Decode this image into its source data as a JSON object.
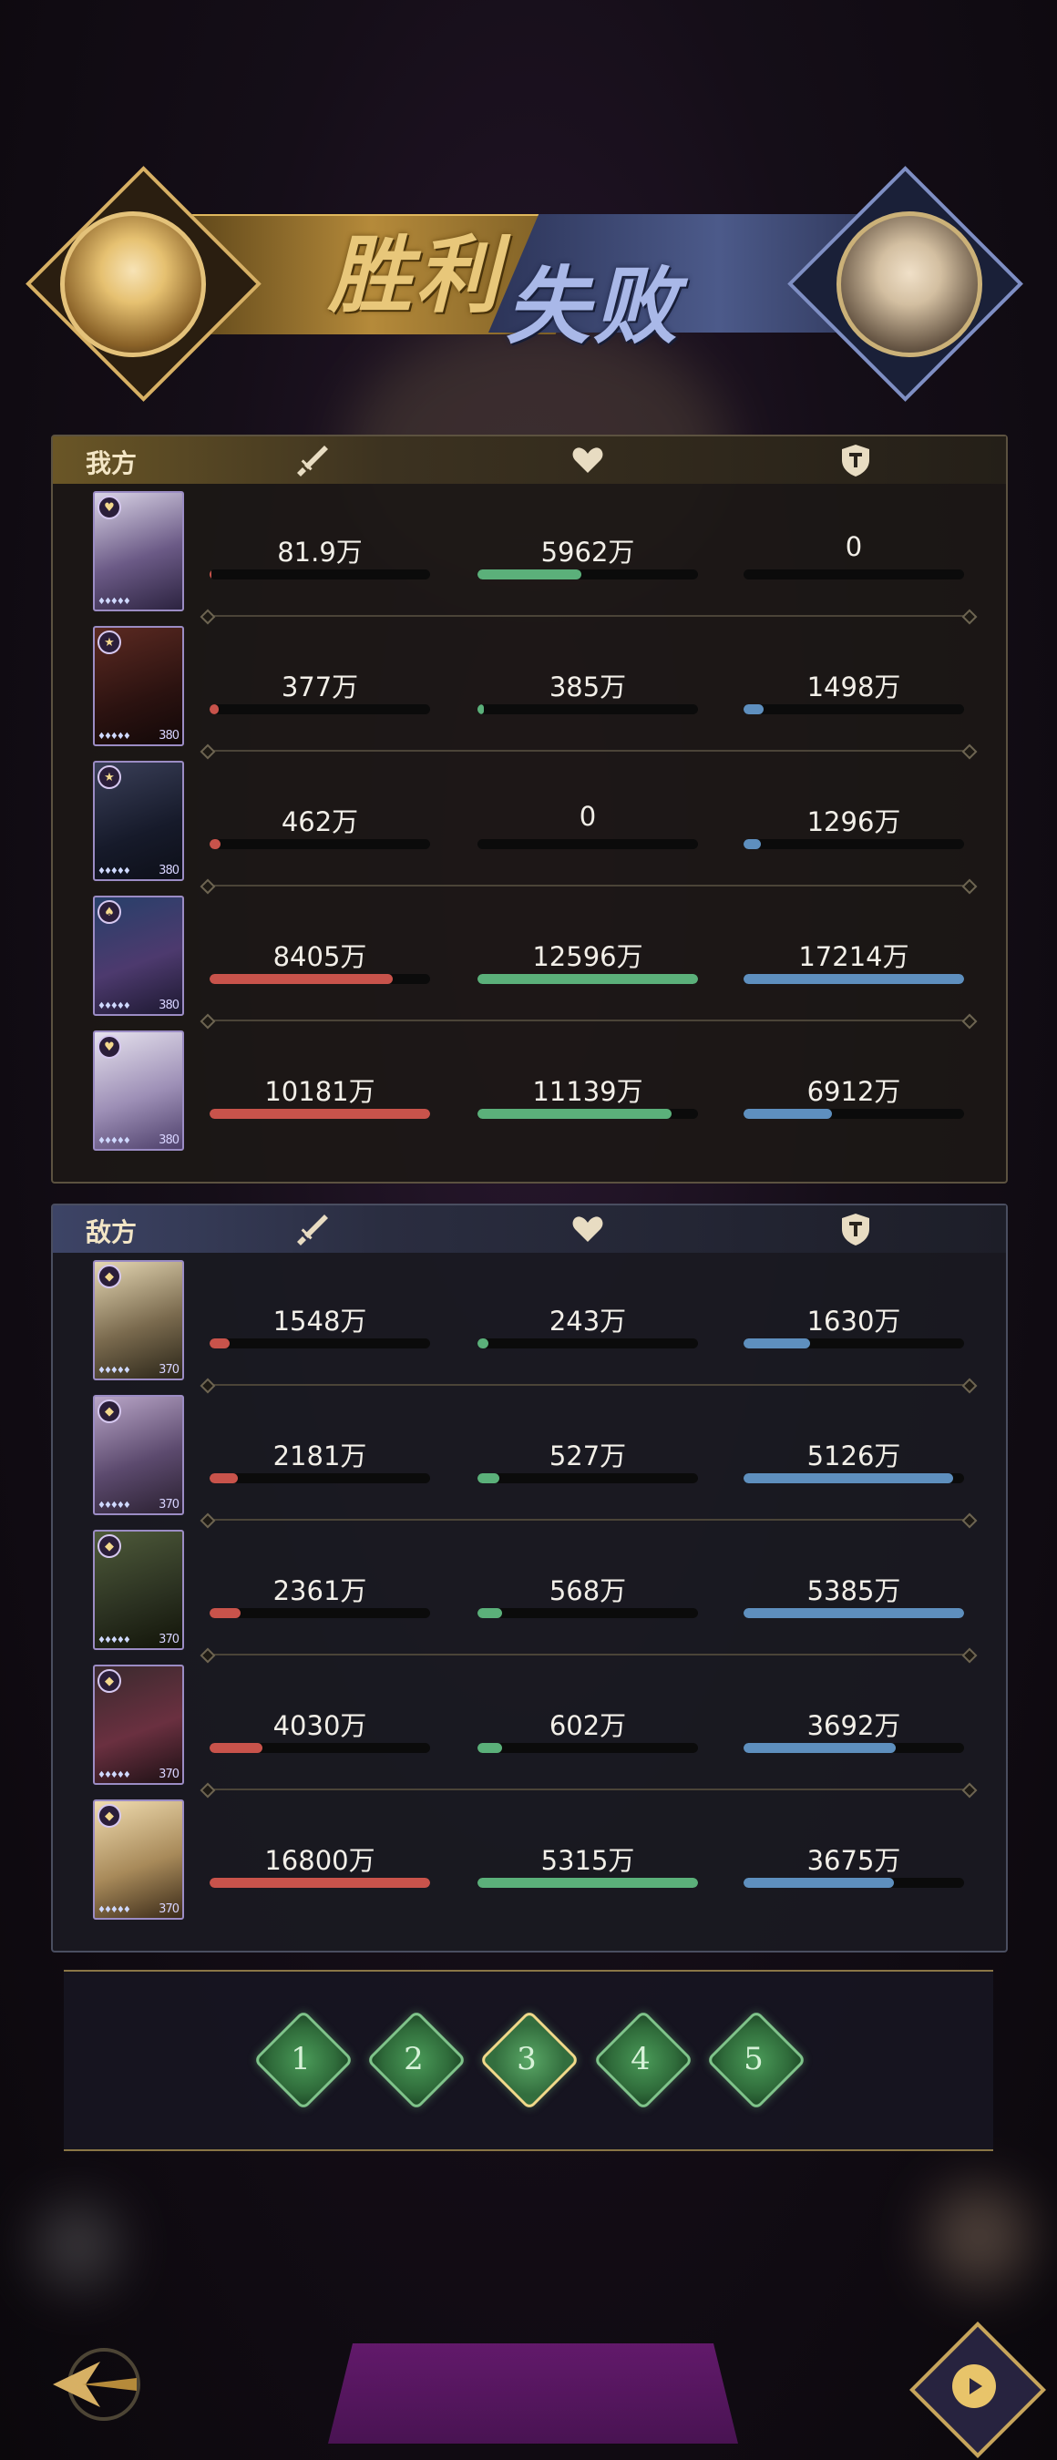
{
  "banner": {
    "win_text": "胜利",
    "lose_text": "失败"
  },
  "ally": {
    "title": "我方",
    "rows": [
      {
        "level": "",
        "atk": "81.9万",
        "hp": "5962万",
        "def": "0",
        "atk_ratio": 0.01,
        "hp_ratio": 0.47,
        "def_ratio": 0.0
      },
      {
        "level": "380",
        "atk": "377万",
        "hp": "385万",
        "def": "1498万",
        "atk_ratio": 0.04,
        "hp_ratio": 0.03,
        "def_ratio": 0.09
      },
      {
        "level": "380",
        "atk": "462万",
        "hp": "0",
        "def": "1296万",
        "atk_ratio": 0.05,
        "hp_ratio": 0.0,
        "def_ratio": 0.08
      },
      {
        "level": "380",
        "atk": "8405万",
        "hp": "12596万",
        "def": "17214万",
        "atk_ratio": 0.83,
        "hp_ratio": 1.0,
        "def_ratio": 1.0
      },
      {
        "level": "380",
        "atk": "10181万",
        "hp": "11139万",
        "def": "6912万",
        "atk_ratio": 1.0,
        "hp_ratio": 0.88,
        "def_ratio": 0.4
      }
    ]
  },
  "enemy": {
    "title": "敌方",
    "rows": [
      {
        "level": "370",
        "atk": "1548万",
        "hp": "243万",
        "def": "1630万",
        "atk_ratio": 0.09,
        "hp_ratio": 0.05,
        "def_ratio": 0.3
      },
      {
        "level": "370",
        "atk": "2181万",
        "hp": "527万",
        "def": "5126万",
        "atk_ratio": 0.13,
        "hp_ratio": 0.1,
        "def_ratio": 0.95
      },
      {
        "level": "370",
        "atk": "2361万",
        "hp": "568万",
        "def": "5385万",
        "atk_ratio": 0.14,
        "hp_ratio": 0.11,
        "def_ratio": 1.0
      },
      {
        "level": "370",
        "atk": "4030万",
        "hp": "602万",
        "def": "3692万",
        "atk_ratio": 0.24,
        "hp_ratio": 0.11,
        "def_ratio": 0.69
      },
      {
        "level": "370",
        "atk": "16800万",
        "hp": "5315万",
        "def": "3675万",
        "atk_ratio": 1.0,
        "hp_ratio": 1.0,
        "def_ratio": 0.68
      }
    ]
  },
  "pager": {
    "pages": [
      "1",
      "2",
      "3",
      "4",
      "5"
    ],
    "active": "3"
  },
  "colors": {
    "attack": "#c8534b",
    "health": "#5bb07a",
    "defense": "#5e8fbe",
    "gold": "#d7b064"
  },
  "icons": {
    "attack": "sword-icon",
    "health": "heart-icon",
    "defense": "shield-icon",
    "back": "back-arrow-icon",
    "replay": "play-icon"
  }
}
